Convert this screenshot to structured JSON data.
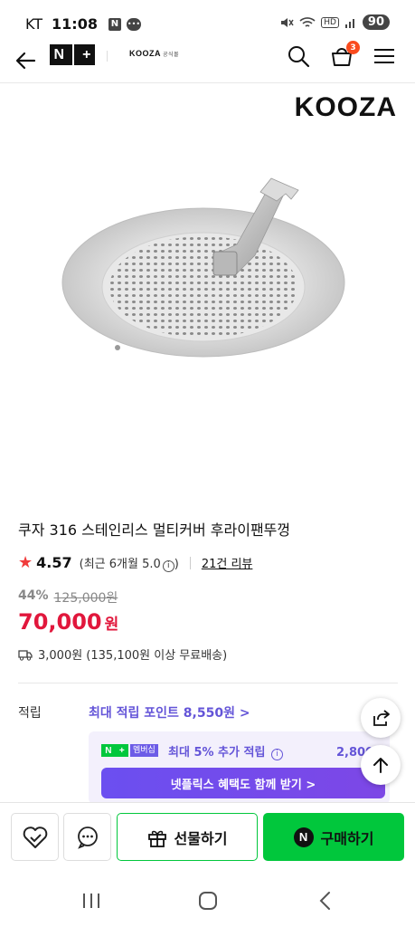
{
  "status_bar": {
    "carrier": "KT",
    "time": "11:08",
    "notif_n": "N",
    "network": "HD",
    "battery": "90"
  },
  "header": {
    "store_name": "KOOZA",
    "store_sub": "공식몰",
    "cart_count": "3"
  },
  "product": {
    "brand_logo": "KOOZA",
    "title": "쿠자 316 스테인리스 멀티커버 후라이팬뚜껑",
    "rating": "4.57",
    "rating_note": "(최근 6개월 5.0",
    "rating_note_close": ")",
    "review_link": "21건 리뷰",
    "discount_rate": "44%",
    "original_price": "125,000원",
    "sale_price": "70,000",
    "sale_unit": "원",
    "shipping": "3,000원 (135,100원 이상 무료배송)"
  },
  "points": {
    "label": "적립",
    "max_points": "최대 적립 포인트 8,550원 >",
    "membership_tag": "멤버십",
    "membership_text": "최대 5% 추가 적립",
    "membership_amount": "2,800원",
    "netflix_button": "넷플릭스 혜택도 함께 받기 >"
  },
  "bottom_bar": {
    "gift_label": "선물하기",
    "buy_label": "구매하기"
  },
  "colors": {
    "sale_red": "#e1173c",
    "naver_green": "#01c73c",
    "points_purple": "#6455d8"
  }
}
